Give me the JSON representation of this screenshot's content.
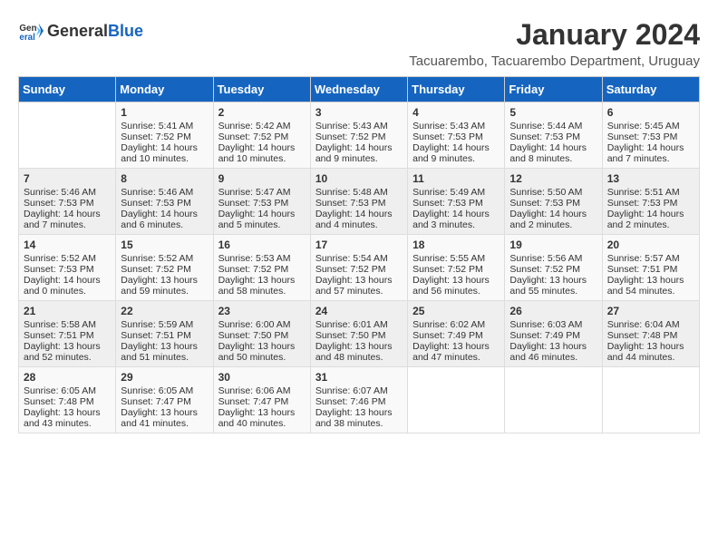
{
  "header": {
    "logo_general": "General",
    "logo_blue": "Blue",
    "main_title": "January 2024",
    "subtitle": "Tacuarembo, Tacuarembo Department, Uruguay"
  },
  "days_of_week": [
    "Sunday",
    "Monday",
    "Tuesday",
    "Wednesday",
    "Thursday",
    "Friday",
    "Saturday"
  ],
  "weeks": [
    [
      {
        "day": "",
        "content": ""
      },
      {
        "day": "1",
        "content": "Sunrise: 5:41 AM\nSunset: 7:52 PM\nDaylight: 14 hours\nand 10 minutes."
      },
      {
        "day": "2",
        "content": "Sunrise: 5:42 AM\nSunset: 7:52 PM\nDaylight: 14 hours\nand 10 minutes."
      },
      {
        "day": "3",
        "content": "Sunrise: 5:43 AM\nSunset: 7:52 PM\nDaylight: 14 hours\nand 9 minutes."
      },
      {
        "day": "4",
        "content": "Sunrise: 5:43 AM\nSunset: 7:53 PM\nDaylight: 14 hours\nand 9 minutes."
      },
      {
        "day": "5",
        "content": "Sunrise: 5:44 AM\nSunset: 7:53 PM\nDaylight: 14 hours\nand 8 minutes."
      },
      {
        "day": "6",
        "content": "Sunrise: 5:45 AM\nSunset: 7:53 PM\nDaylight: 14 hours\nand 7 minutes."
      }
    ],
    [
      {
        "day": "7",
        "content": "Sunrise: 5:46 AM\nSunset: 7:53 PM\nDaylight: 14 hours\nand 7 minutes."
      },
      {
        "day": "8",
        "content": "Sunrise: 5:46 AM\nSunset: 7:53 PM\nDaylight: 14 hours\nand 6 minutes."
      },
      {
        "day": "9",
        "content": "Sunrise: 5:47 AM\nSunset: 7:53 PM\nDaylight: 14 hours\nand 5 minutes."
      },
      {
        "day": "10",
        "content": "Sunrise: 5:48 AM\nSunset: 7:53 PM\nDaylight: 14 hours\nand 4 minutes."
      },
      {
        "day": "11",
        "content": "Sunrise: 5:49 AM\nSunset: 7:53 PM\nDaylight: 14 hours\nand 3 minutes."
      },
      {
        "day": "12",
        "content": "Sunrise: 5:50 AM\nSunset: 7:53 PM\nDaylight: 14 hours\nand 2 minutes."
      },
      {
        "day": "13",
        "content": "Sunrise: 5:51 AM\nSunset: 7:53 PM\nDaylight: 14 hours\nand 2 minutes."
      }
    ],
    [
      {
        "day": "14",
        "content": "Sunrise: 5:52 AM\nSunset: 7:53 PM\nDaylight: 14 hours\nand 0 minutes."
      },
      {
        "day": "15",
        "content": "Sunrise: 5:52 AM\nSunset: 7:52 PM\nDaylight: 13 hours\nand 59 minutes."
      },
      {
        "day": "16",
        "content": "Sunrise: 5:53 AM\nSunset: 7:52 PM\nDaylight: 13 hours\nand 58 minutes."
      },
      {
        "day": "17",
        "content": "Sunrise: 5:54 AM\nSunset: 7:52 PM\nDaylight: 13 hours\nand 57 minutes."
      },
      {
        "day": "18",
        "content": "Sunrise: 5:55 AM\nSunset: 7:52 PM\nDaylight: 13 hours\nand 56 minutes."
      },
      {
        "day": "19",
        "content": "Sunrise: 5:56 AM\nSunset: 7:52 PM\nDaylight: 13 hours\nand 55 minutes."
      },
      {
        "day": "20",
        "content": "Sunrise: 5:57 AM\nSunset: 7:51 PM\nDaylight: 13 hours\nand 54 minutes."
      }
    ],
    [
      {
        "day": "21",
        "content": "Sunrise: 5:58 AM\nSunset: 7:51 PM\nDaylight: 13 hours\nand 52 minutes."
      },
      {
        "day": "22",
        "content": "Sunrise: 5:59 AM\nSunset: 7:51 PM\nDaylight: 13 hours\nand 51 minutes."
      },
      {
        "day": "23",
        "content": "Sunrise: 6:00 AM\nSunset: 7:50 PM\nDaylight: 13 hours\nand 50 minutes."
      },
      {
        "day": "24",
        "content": "Sunrise: 6:01 AM\nSunset: 7:50 PM\nDaylight: 13 hours\nand 48 minutes."
      },
      {
        "day": "25",
        "content": "Sunrise: 6:02 AM\nSunset: 7:49 PM\nDaylight: 13 hours\nand 47 minutes."
      },
      {
        "day": "26",
        "content": "Sunrise: 6:03 AM\nSunset: 7:49 PM\nDaylight: 13 hours\nand 46 minutes."
      },
      {
        "day": "27",
        "content": "Sunrise: 6:04 AM\nSunset: 7:48 PM\nDaylight: 13 hours\nand 44 minutes."
      }
    ],
    [
      {
        "day": "28",
        "content": "Sunrise: 6:05 AM\nSunset: 7:48 PM\nDaylight: 13 hours\nand 43 minutes."
      },
      {
        "day": "29",
        "content": "Sunrise: 6:05 AM\nSunset: 7:47 PM\nDaylight: 13 hours\nand 41 minutes."
      },
      {
        "day": "30",
        "content": "Sunrise: 6:06 AM\nSunset: 7:47 PM\nDaylight: 13 hours\nand 40 minutes."
      },
      {
        "day": "31",
        "content": "Sunrise: 6:07 AM\nSunset: 7:46 PM\nDaylight: 13 hours\nand 38 minutes."
      },
      {
        "day": "",
        "content": ""
      },
      {
        "day": "",
        "content": ""
      },
      {
        "day": "",
        "content": ""
      }
    ]
  ]
}
